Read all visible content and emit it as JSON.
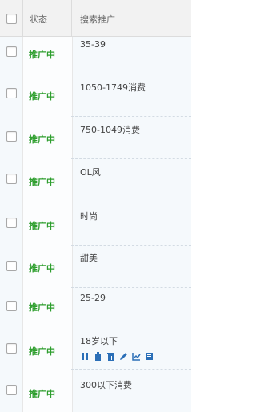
{
  "header": {
    "status": "状态",
    "keyword": "搜索推广"
  },
  "rows": [
    {
      "keyword": "35-39",
      "status": "推广中"
    },
    {
      "keyword": "1050-1749消费",
      "status": "推广中"
    },
    {
      "keyword": "750-1049消费",
      "status": "推广中"
    },
    {
      "keyword": "OL风",
      "status": "推广中"
    },
    {
      "keyword": "时尚",
      "status": "推广中"
    },
    {
      "keyword": "甜美",
      "status": "推广中"
    },
    {
      "keyword": "25-29",
      "status": "推广中"
    },
    {
      "keyword": "18岁以下",
      "status": "推广中"
    },
    {
      "keyword": "300以下消费",
      "status": "推广中"
    }
  ],
  "row_actions": [
    "pause-icon",
    "copy-icon",
    "delete-icon",
    "edit-icon",
    "chart-icon",
    "report-icon"
  ],
  "colors": {
    "status": "#2e9e2e",
    "action_icons": "#2b6fb7"
  }
}
